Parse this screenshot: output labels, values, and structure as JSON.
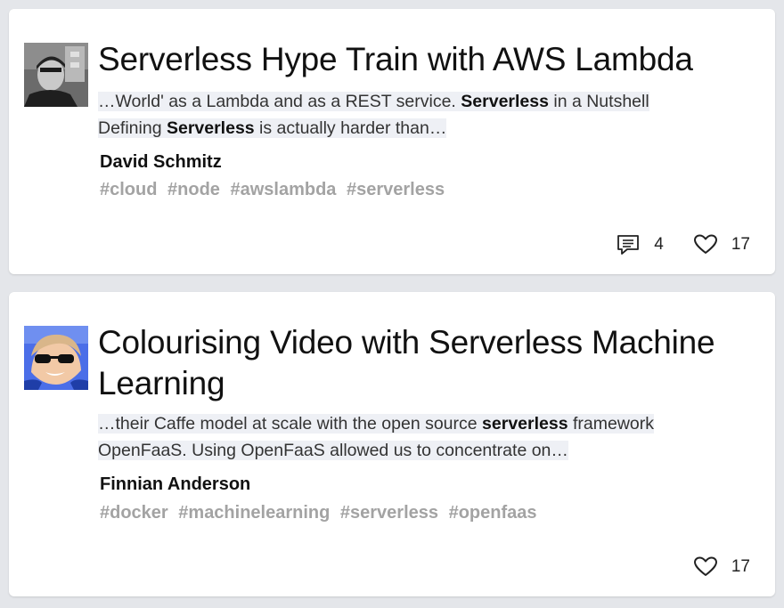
{
  "articles": [
    {
      "title": "Serverless Hype Train with AWS Lambda",
      "snippet_line1_pre": "…World' as a Lambda and as a REST service. ",
      "snippet_line1_bold": "Serverless",
      "snippet_line1_post": " in a Nutshell",
      "snippet_line2_pre": "Defining ",
      "snippet_line2_bold": "Serverless",
      "snippet_line2_post": " is actually harder than…",
      "author": "David Schmitz",
      "tags": [
        "#cloud",
        "#node",
        "#awslambda",
        "#serverless"
      ],
      "comments": "4",
      "likes": "17",
      "avatar_icon": "person-photo-avatar"
    },
    {
      "title": "Colourising Video with Serverless Machine Learning",
      "snippet_line1_pre": "…their Caffe model at scale with the open source ",
      "snippet_line1_bold": "serverless",
      "snippet_line1_post": " framework",
      "snippet_line2_pre": "OpenFaaS. Using OpenFaaS allowed us to concentrate on…",
      "snippet_line2_bold": "",
      "snippet_line2_post": "",
      "author": "Finnian Anderson",
      "tags": [
        "#docker",
        "#machinelearning",
        "#serverless",
        "#openfaas"
      ],
      "likes": "17",
      "avatar_icon": "person-photo-avatar"
    }
  ],
  "icons": {
    "comment": "comment-icon",
    "like": "heart-icon"
  }
}
